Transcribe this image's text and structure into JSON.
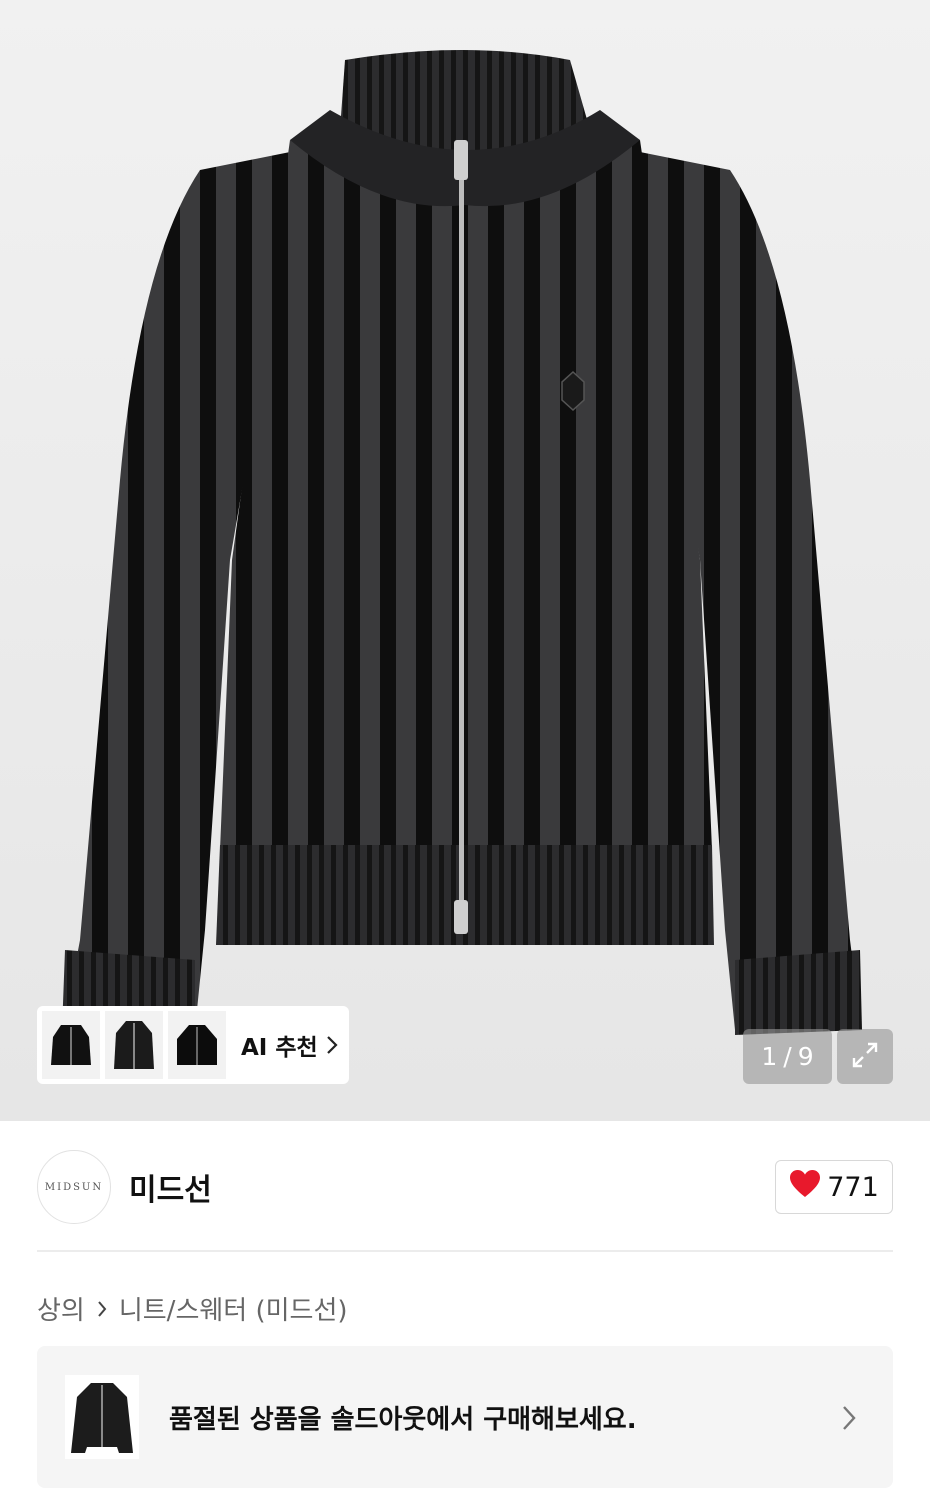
{
  "product_image": {
    "counter_current": "1",
    "counter_separator": "/",
    "counter_total": "9",
    "ai_recommend_label": "AI 추천"
  },
  "brand": {
    "logo_text": "MIDSUN",
    "name": "미드선",
    "like_count": "771",
    "like_color": "#e8192c"
  },
  "breadcrumb": {
    "category": "상의",
    "subcategory": "니트/스웨터 (미드선)"
  },
  "soldout_banner": {
    "text": "품절된 상품을 솔드아웃에서 구매해보세요."
  },
  "icons": [
    "expand-icon",
    "heart-icon",
    "chevron-right-icon"
  ]
}
